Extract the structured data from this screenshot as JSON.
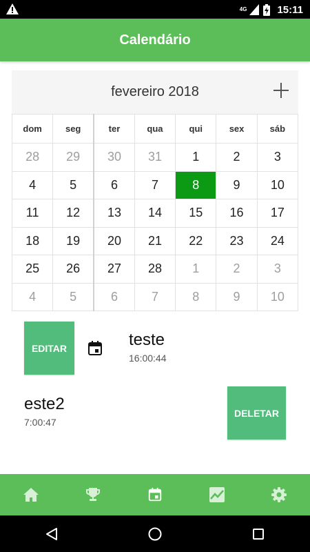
{
  "status_bar": {
    "network": "4G",
    "time": "15:11",
    "icons": [
      "warning-icon",
      "signal-icon",
      "battery-charging-icon"
    ]
  },
  "app_bar": {
    "title": "Calendário"
  },
  "calendar": {
    "month_label": "fevereiro 2018",
    "add_icon": "plus-icon",
    "weekdays": [
      "dom",
      "seg",
      "ter",
      "qua",
      "qui",
      "sex",
      "sáb"
    ],
    "weeks": [
      [
        "28",
        "29",
        "30",
        "31",
        "1",
        "2",
        "3"
      ],
      [
        "4",
        "5",
        "6",
        "7",
        "8",
        "9",
        "10"
      ],
      [
        "11",
        "12",
        "13",
        "14",
        "15",
        "16",
        "17"
      ],
      [
        "18",
        "19",
        "20",
        "21",
        "22",
        "23",
        "24"
      ],
      [
        "25",
        "26",
        "27",
        "28",
        "1",
        "2",
        "3"
      ],
      [
        "4",
        "5",
        "6",
        "7",
        "8",
        "9",
        "10"
      ]
    ],
    "selected_day": "8",
    "selected_color": "#0c9a15"
  },
  "events": [
    {
      "title": "teste",
      "time": "16:00:44",
      "button_label": "EDITAR",
      "icon": "calendar-event-icon"
    },
    {
      "title": "este2",
      "time": "7:00:47",
      "button_label": "DELETAR"
    }
  ],
  "bottom_nav": {
    "items": [
      "home-icon",
      "trophy-icon",
      "calendar-icon",
      "chart-icon",
      "settings-icon"
    ],
    "active_color": "#5cbe58"
  },
  "system_nav": {
    "items": [
      "back-icon",
      "home-circle-icon",
      "recents-icon"
    ]
  },
  "colors": {
    "accent": "#5cbe58",
    "button": "#51bc7b"
  }
}
